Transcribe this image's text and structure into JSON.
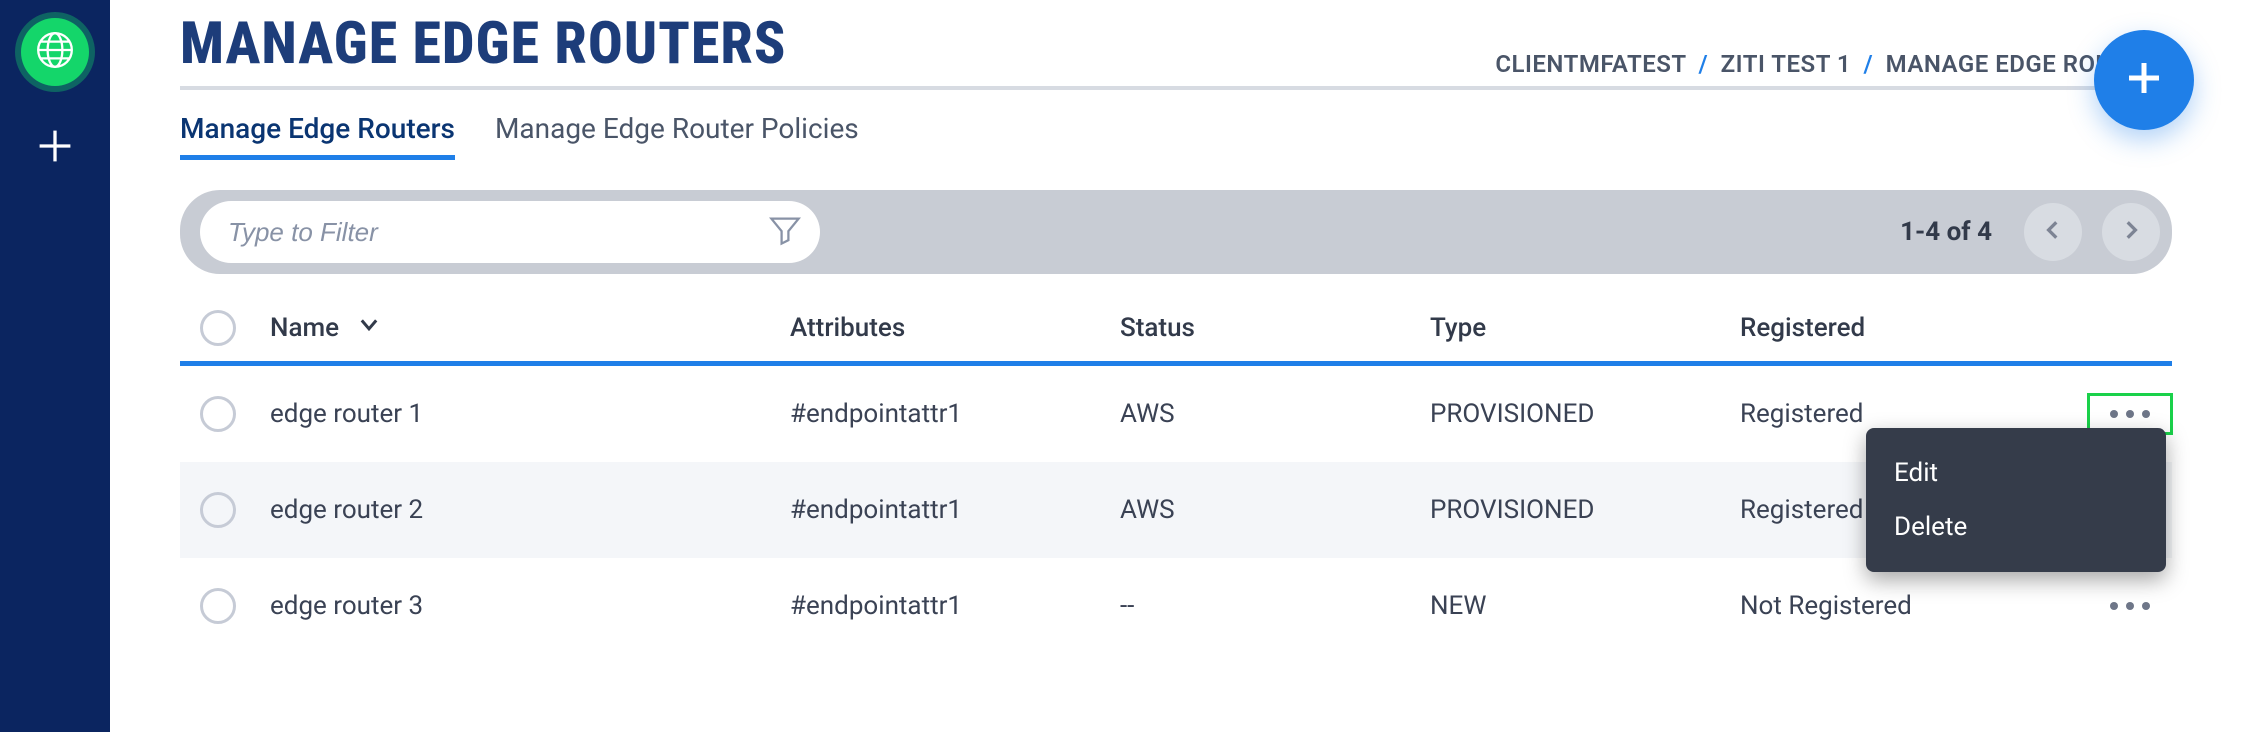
{
  "page": {
    "title": "MANAGE EDGE ROUTERS"
  },
  "breadcrumb": {
    "part1": "CLIENTMFATEST",
    "part2": "ZITI TEST 1",
    "part3": "MANAGE EDGE ROUTERS",
    "sep": "/"
  },
  "tabs": {
    "manage_routers": "Manage Edge Routers",
    "manage_policies": "Manage Edge Router Policies"
  },
  "filter": {
    "placeholder": "Type to Filter",
    "page_count": "1-4 of 4"
  },
  "columns": {
    "name": "Name",
    "attributes": "Attributes",
    "status": "Status",
    "type": "Type",
    "registered": "Registered"
  },
  "rows": [
    {
      "name": "edge router 1",
      "attributes": "#endpointattr1",
      "status": "AWS",
      "type": "PROVISIONED",
      "registered": "Registered"
    },
    {
      "name": "edge router 2",
      "attributes": "#endpointattr1",
      "status": "AWS",
      "type": "PROVISIONED",
      "registered": "Registered"
    },
    {
      "name": "edge router 3",
      "attributes": "#endpointattr1",
      "status": "--",
      "type": "NEW",
      "registered": "Not Registered"
    }
  ],
  "context_menu": {
    "edit": "Edit",
    "delete": "Delete"
  }
}
